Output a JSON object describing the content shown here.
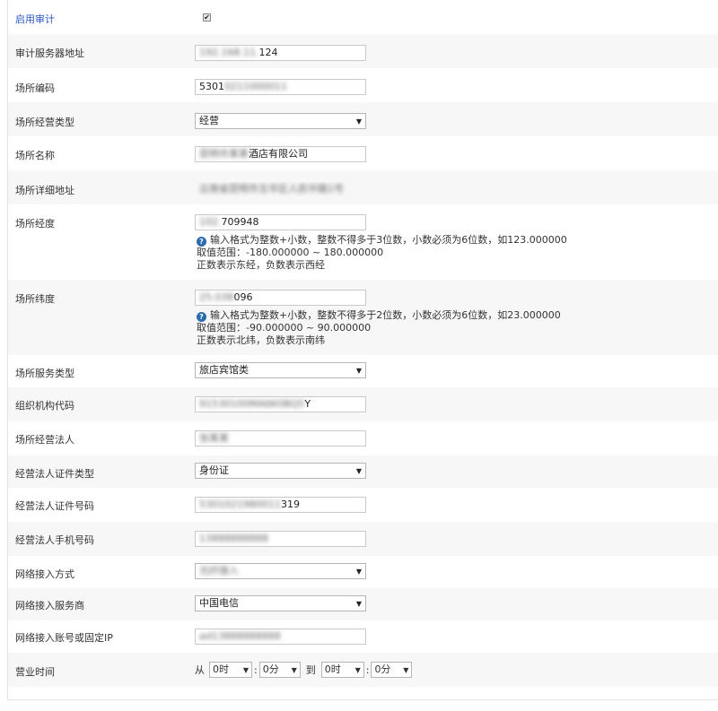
{
  "enable_audit": {
    "label": "启用审计",
    "checked": true,
    "check_glyph": "✔"
  },
  "arrow_glyph": "▼",
  "hint_glyph": "?",
  "fields": {
    "audit_server": {
      "label": "审计服务器地址",
      "value_hidden": "192.168.11.",
      "value_visible": "124"
    },
    "site_code": {
      "label": "场所编码",
      "value_visible": "5301",
      "value_hidden": "0211000011"
    },
    "site_business_type": {
      "label": "场所经营类型",
      "selected": "经营"
    },
    "site_name": {
      "label": "场所名称",
      "value_hidden": "昆明市某某",
      "value_visible": "酒店有限公司"
    },
    "site_address": {
      "label": "场所详细地址",
      "value_hidden": "云南省昆明市五华区人民中路1号"
    },
    "longitude": {
      "label": "场所经度",
      "value_hidden": "102.",
      "value_visible": "709948",
      "hint_line1": "输入格式为整数+小数，整数不得多于3位数，小数必须为6位数，如123.000000",
      "hint_line2": "取值范围：-180.000000 ~ 180.000000",
      "hint_line3": "正数表示东经，负数表示西经"
    },
    "latitude": {
      "label": "场所纬度",
      "value_hidden": "25.038",
      "value_visible": "096",
      "hint_line1": "输入格式为整数+小数，整数不得多于2位数，小数必须为6位数，如23.000000",
      "hint_line2": "取值范围：-90.000000 ~ 90.000000",
      "hint_line3": "正数表示北纬，负数表示南纬"
    },
    "site_service_type": {
      "label": "场所服务类型",
      "selected": "旅店宾馆类"
    },
    "org_code": {
      "label": "组织机构代码",
      "value_hidden": "91530100MA6K0BQ5",
      "value_visible": "Y"
    },
    "legal_person": {
      "label": "场所经营法人",
      "value_hidden": "张某某"
    },
    "legal_id_type": {
      "label": "经营法人证件类型",
      "selected": "身份证"
    },
    "legal_id_number": {
      "label": "经营法人证件号码",
      "value_hidden": "5301021980011",
      "value_visible": "319"
    },
    "legal_phone": {
      "label": "经营法人手机号码",
      "value_hidden": "13888888888"
    },
    "network_access_mode": {
      "label": "网络接入方式",
      "selected_hidden": "光纤接入"
    },
    "network_provider": {
      "label": "网络接入服务商",
      "selected": "中国电信"
    },
    "network_account": {
      "label": "网络接入账号或固定IP",
      "value_hidden": "ad13888888888"
    },
    "business_hours": {
      "label": "营业时间",
      "from_label": "从",
      "to_label": "到",
      "colon": ":",
      "start_hour": "0时",
      "start_minute": "0分",
      "end_hour": "0时",
      "end_minute": "0分"
    }
  }
}
